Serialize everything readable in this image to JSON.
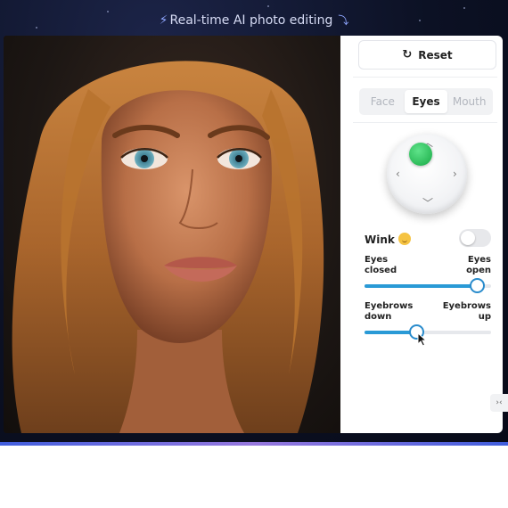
{
  "header": {
    "headline": "Real-time AI photo editing"
  },
  "photo": {
    "alt_subject": "portrait"
  },
  "panel": {
    "reset_label": "Reset",
    "tabs": [
      {
        "label": "Face",
        "active": false
      },
      {
        "label": "Eyes",
        "active": true
      },
      {
        "label": "Mouth",
        "active": false
      }
    ],
    "joystick": {
      "accent_color": "#2dbb5a"
    },
    "wink": {
      "label": "Wink",
      "enabled": false
    },
    "sliders": [
      {
        "left_label_line1": "Eyes",
        "left_label_line2": "closed",
        "right_label_line1": "Eyes",
        "right_label_line2": "open",
        "value": 0.89
      },
      {
        "left_label_line1": "Eyebrows",
        "left_label_line2": "down",
        "right_label_line1": "Eyebrows",
        "right_label_line2": "up",
        "value": 0.41
      }
    ],
    "accent_color": "#2a9ad6"
  },
  "icons": {
    "bolt": "lightning-bolt-icon",
    "reset": "rotate-cw-icon",
    "collapse": "collapse-panel-icon"
  }
}
